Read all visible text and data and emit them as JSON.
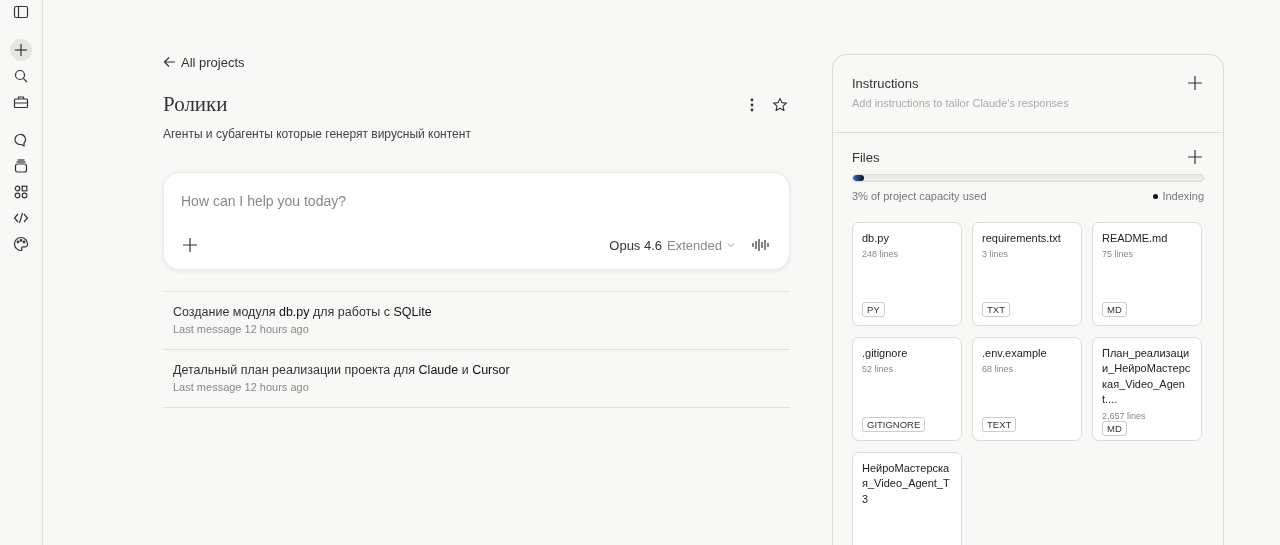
{
  "back_link": {
    "label": "All projects"
  },
  "project": {
    "title": "Ролики",
    "description": "Агенты и субагенты которые генерят вирусный контент",
    "starred": false
  },
  "composer": {
    "placeholder": "How can I help you today?",
    "model": "Opus 4.6",
    "mode": "Extended"
  },
  "conversations": [
    {
      "title": "Создание модуля **db.py** для работы с **SQLite**",
      "meta": "Last message 12 hours ago"
    },
    {
      "title": "Детальный план реализации проекта для **Claude** и **Cursor**",
      "meta": "Last message 12 hours ago"
    }
  ],
  "instructions": {
    "title": "Instructions",
    "hint": "Add instructions to tailor Claude's responses"
  },
  "files": {
    "title": "Files",
    "capacity": {
      "level": 0.03,
      "label": "3% of project capacity used"
    },
    "status": "Indexing",
    "items": [
      {
        "name": "db.py",
        "lines": "248 lines",
        "type": "PY"
      },
      {
        "name": "requirements.txt",
        "lines": "3 lines",
        "type": "TXT"
      },
      {
        "name": "README.md",
        "lines": "75 lines",
        "type": "MD"
      },
      {
        "name": ".gitignore",
        "lines": "52 lines",
        "type": "GITIGNORE"
      },
      {
        "name": ".env.example",
        "lines": "68 lines",
        "type": "TEXT"
      },
      {
        "name": "План_реализации_НейроМастерская_Video_Agent....",
        "lines": "2,657 lines",
        "type": "MD"
      },
      {
        "name": "НейроМастерская_Video_Agent_T3"
      }
    ]
  }
}
